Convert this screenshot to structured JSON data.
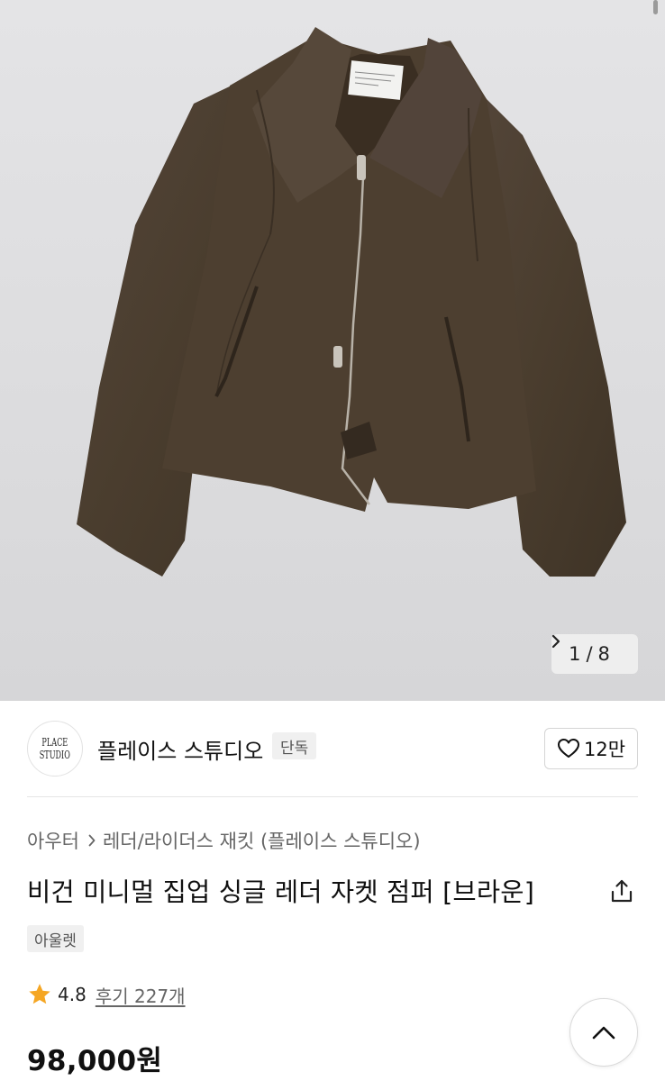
{
  "gallery": {
    "current": "1",
    "separator": "/",
    "total": "8",
    "image_alt": "brown-zip-jacket-photo"
  },
  "brand": {
    "logo_text": "PLACE STUDIO",
    "name": "플레이스 스튜디오",
    "badge": "단독",
    "like_count": "12만"
  },
  "breadcrumb": {
    "level1": "아우터",
    "level2": "레더/라이더스 재킷 (플레이스 스튜디오)"
  },
  "product": {
    "title": "비건 미니멀 집업 싱글 레더 자켓 점퍼 [브라운]",
    "tag": "아울렛",
    "rating": "4.8",
    "reviews": "후기 227개",
    "price": "98,000원"
  },
  "icons": {
    "next": "chevron-right-icon",
    "like": "heart-icon",
    "share": "share-icon",
    "star": "star-icon",
    "top": "chevron-up-icon"
  },
  "colors": {
    "star": "#f5a623",
    "jacket": "#4a3d2c",
    "background": "#ffffff"
  }
}
